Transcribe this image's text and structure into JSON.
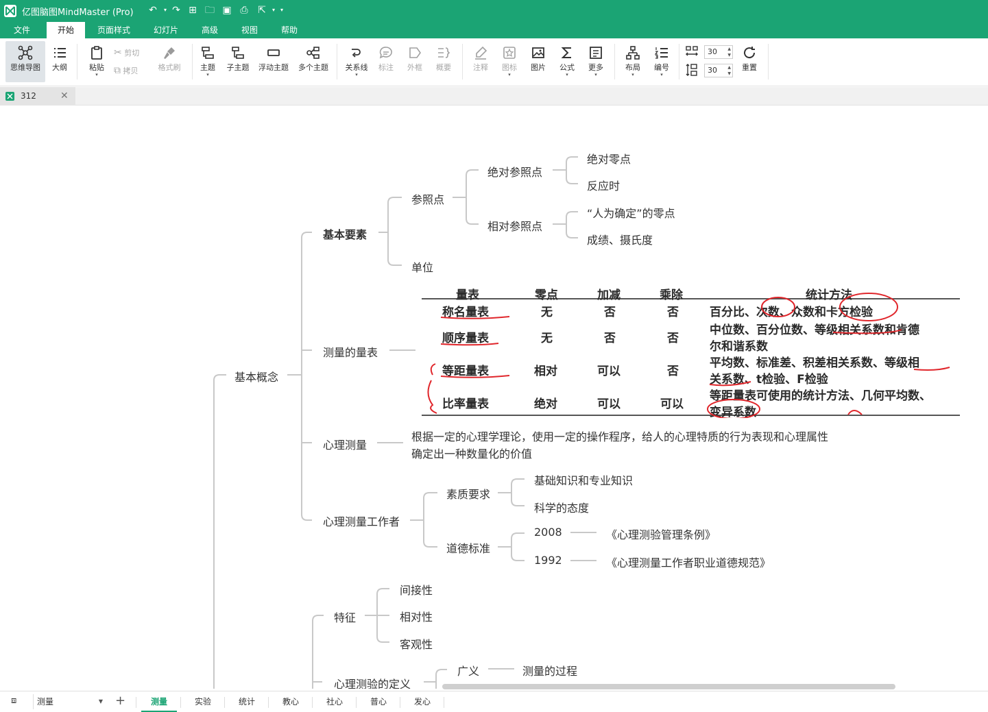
{
  "app": {
    "title": "亿图脑图MindMaster (Pro)"
  },
  "menu": [
    "文件",
    "开始",
    "页面样式",
    "幻灯片",
    "高级",
    "视图",
    "帮助"
  ],
  "ribbon": {
    "mindmap": "思维导图",
    "outline": "大纲",
    "paste": "粘贴",
    "cut": "剪切",
    "copy": "拷贝",
    "format_painter": "格式刷",
    "topic": "主题",
    "subtopic": "子主题",
    "floating": "浮动主题",
    "multi": "多个主题",
    "relation": "关系线",
    "callout": "标注",
    "boundary": "外框",
    "summary": "概要",
    "note": "注释",
    "icon": "图标",
    "image": "图片",
    "formula": "公式",
    "more": "更多",
    "layout": "布局",
    "numbering": "编号",
    "spacing_h": "30",
    "spacing_v": "30",
    "reset": "重置"
  },
  "doc_tab": {
    "name": "312"
  },
  "mindmap": {
    "root": "基本概念",
    "basic_elements": "基本要素",
    "reference_point": "参照点",
    "absolute_ref": "绝对参照点",
    "absolute_zero": "绝对零点",
    "reaction_time": "反应时",
    "relative_ref": "相对参照点",
    "human_zero": "“人为确定”的零点",
    "grades": "成绩、摄氏度",
    "unit": "单位",
    "scales": "测量的量表",
    "psych_measure": "心理测量",
    "psych_def_1": "根据一定的心理学理论，使用一定的操作程序，给人的心理特质的行为表现和心理属性",
    "psych_def_2": "确定出一种数量化的价值",
    "workers": "心理测量工作者",
    "quality": "素质要求",
    "knowledge": "基础知识和专业知识",
    "attitude": "科学的态度",
    "ethics": "道德标准",
    "year_2008": "2008",
    "reg_2008": "《心理测验管理条例》",
    "year_1992": "1992",
    "reg_1992": "《心理测量工作者职业道德规范》",
    "features": "特征",
    "indirect": "间接性",
    "relative": "相对性",
    "objective": "客观性",
    "definition": "心理测验的定义",
    "broad": "广义",
    "process": "测量的过程"
  },
  "scale_table": {
    "headers": [
      "量表",
      "零点",
      "加减",
      "乘除",
      "统计方法"
    ],
    "rows": [
      [
        "称名量表",
        "无",
        "否",
        "否",
        "百分比、次数、众数和卡方检验"
      ],
      [
        "顺序量表",
        "无",
        "否",
        "否",
        "中位数、百分位数、等级相关系数和肯德",
        "尔和谐系数"
      ],
      [
        "等距量表",
        "相对",
        "可以",
        "否",
        "平均数、标准差、积差相关系数、等级相",
        "关系数、t检验、F检验"
      ],
      [
        "比率量表",
        "绝对",
        "可以",
        "可以",
        "等距量表可使用的统计方法、几何平均数、",
        "变异系数"
      ]
    ]
  },
  "sheets": {
    "current": "测量",
    "tabs": [
      "测量",
      "实验",
      "统计",
      "教心",
      "社心",
      "普心",
      "发心"
    ]
  }
}
